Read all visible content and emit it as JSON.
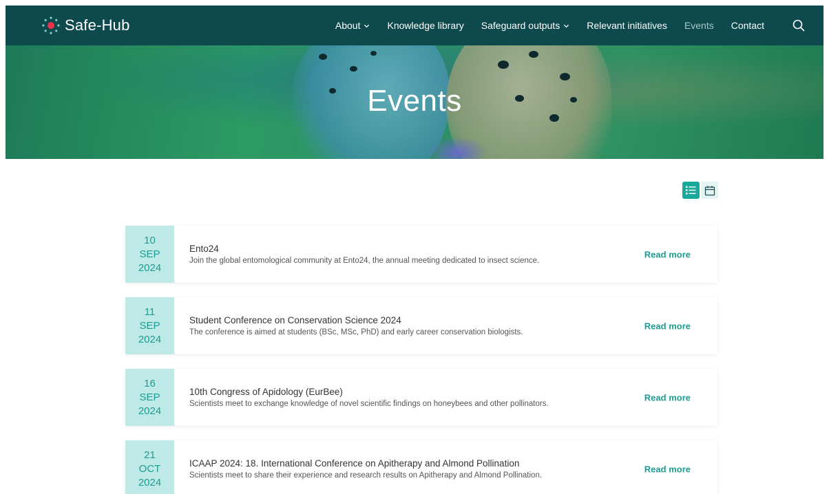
{
  "header": {
    "logo_text": "Safe-Hub",
    "nav": [
      {
        "label": "About",
        "has_dropdown": true,
        "active": false
      },
      {
        "label": "Knowledge library",
        "has_dropdown": false,
        "active": false
      },
      {
        "label": "Safeguard outputs",
        "has_dropdown": true,
        "active": false
      },
      {
        "label": "Relevant initiatives",
        "has_dropdown": false,
        "active": false
      },
      {
        "label": "Events",
        "has_dropdown": false,
        "active": true
      },
      {
        "label": "Contact",
        "has_dropdown": false,
        "active": false
      }
    ],
    "search_icon": "search-icon"
  },
  "hero": {
    "title": "Events"
  },
  "view_toggle": {
    "list_icon": "list-view-icon",
    "calendar_icon": "calendar-view-icon",
    "active": "list"
  },
  "events": [
    {
      "day": "10",
      "month": "SEP",
      "year": "2024",
      "title": "Ento24",
      "description": "Join the global entomological community at Ento24, the annual meeting dedicated to insect science.",
      "link_label": "Read more"
    },
    {
      "day": "11",
      "month": "SEP",
      "year": "2024",
      "title": "Student Conference on Conservation Science 2024",
      "description": "The conference is aimed at students (BSc, MSc, PhD) and early career conservation biologists.",
      "link_label": "Read more"
    },
    {
      "day": "16",
      "month": "SEP",
      "year": "2024",
      "title": "10th Congress of Apidology (EurBee)",
      "description": "Scientists meet to exchange knowledge of novel scientific findings on honeybees and other pollinators.",
      "link_label": "Read more"
    },
    {
      "day": "21",
      "month": "OCT",
      "year": "2024",
      "title": "ICAAP 2024: 18. International Conference on Apitherapy and Almond Pollination",
      "description": "Scientists meet to share their experience and research results on Apitherapy and Almond Pollination.",
      "link_label": "Read more"
    }
  ],
  "colors": {
    "header_bg": "#0e4a4d",
    "accent": "#1c9d92",
    "date_bg": "#bfe9e6",
    "logo_accent": "#e8334a"
  }
}
